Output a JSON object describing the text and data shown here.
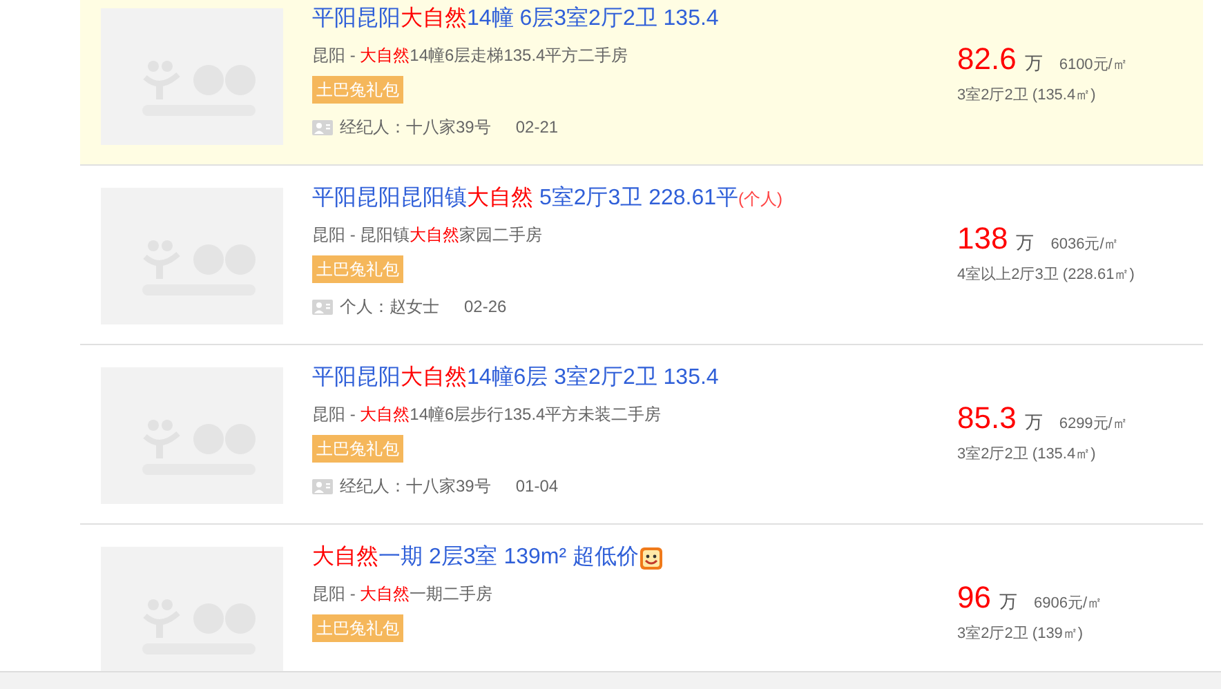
{
  "listings": [
    {
      "highlighted": true,
      "title": [
        {
          "text": "平阳昆阳",
          "kind": "plain"
        },
        {
          "text": "大自然",
          "kind": "keyword"
        },
        {
          "text": "14幢 6层3室2厅2卫 135.4",
          "kind": "plain"
        }
      ],
      "smiley": false,
      "subtitle": [
        {
          "text": "昆阳 - ",
          "kind": "plain"
        },
        {
          "text": "大自然",
          "kind": "keyword"
        },
        {
          "text": "14幢6层走梯135.4平方二手房",
          "kind": "plain"
        }
      ],
      "badge": "土巴兔礼包",
      "contact": "经纪人：十八家39号",
      "date": "02-21",
      "price": "82.6",
      "price_unit": "万",
      "unit_price": "6100元/㎡",
      "layout": "3室2厅2卫 (135.4㎡)"
    },
    {
      "highlighted": false,
      "title": [
        {
          "text": "平阳昆阳昆阳镇",
          "kind": "plain"
        },
        {
          "text": "大自然",
          "kind": "keyword"
        },
        {
          "text": " 5室2厅3卫 228.61平",
          "kind": "plain"
        },
        {
          "text": "(个人)",
          "kind": "tag"
        }
      ],
      "smiley": false,
      "subtitle": [
        {
          "text": "昆阳 - 昆阳镇",
          "kind": "plain"
        },
        {
          "text": "大自然",
          "kind": "keyword"
        },
        {
          "text": "家园二手房",
          "kind": "plain"
        }
      ],
      "badge": "土巴兔礼包",
      "contact": "个人：赵女士",
      "date": "02-26",
      "price": "138",
      "price_unit": "万",
      "unit_price": "6036元/㎡",
      "layout": "4室以上2厅3卫 (228.61㎡)"
    },
    {
      "highlighted": false,
      "title": [
        {
          "text": "平阳昆阳",
          "kind": "plain"
        },
        {
          "text": "大自然",
          "kind": "keyword"
        },
        {
          "text": "14幢6层 3室2厅2卫 135.4",
          "kind": "plain"
        }
      ],
      "smiley": false,
      "subtitle": [
        {
          "text": "昆阳 - ",
          "kind": "plain"
        },
        {
          "text": "大自然",
          "kind": "keyword"
        },
        {
          "text": "14幢6层步行135.4平方未装二手房",
          "kind": "plain"
        }
      ],
      "badge": "土巴兔礼包",
      "contact": "经纪人：十八家39号",
      "date": "01-04",
      "price": "85.3",
      "price_unit": "万",
      "unit_price": "6299元/㎡",
      "layout": "3室2厅2卫 (135.4㎡)"
    },
    {
      "highlighted": false,
      "title": [
        {
          "text": "大自然",
          "kind": "keyword"
        },
        {
          "text": "一期 2层3室 139m² 超低价",
          "kind": "plain"
        }
      ],
      "smiley": true,
      "subtitle": [
        {
          "text": "昆阳 - ",
          "kind": "plain"
        },
        {
          "text": "大自然",
          "kind": "keyword"
        },
        {
          "text": "一期二手房",
          "kind": "plain"
        }
      ],
      "badge": "土巴兔礼包",
      "price": "96",
      "price_unit": "万",
      "unit_price": "6906元/㎡",
      "layout": "3室2厅2卫 (139㎡)"
    }
  ]
}
